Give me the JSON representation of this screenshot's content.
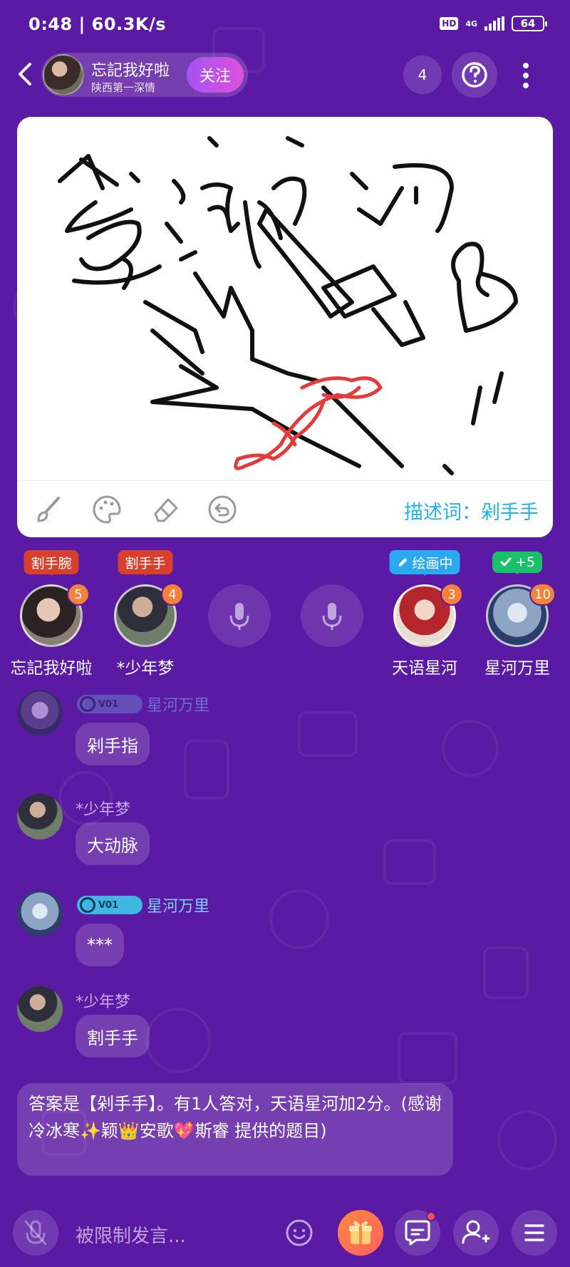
{
  "status_bar": {
    "time_speed": "0:48 | 60.3K/s",
    "hd": "HD",
    "network": "4G",
    "battery": "64"
  },
  "header": {
    "host_name": "忘記我好啦",
    "host_subtitle": "陕西第一深情",
    "follow_label": "关注",
    "online_count": "4"
  },
  "canvas": {
    "hint_label": "描述词：剁手手"
  },
  "seats": [
    {
      "tag": "割手腕",
      "tag_color": "#d8402e",
      "score": "5",
      "name": "忘記我好啦"
    },
    {
      "tag": "割手手",
      "tag_color": "#d8402e",
      "score": "4",
      "name": "*少年梦"
    },
    {
      "empty": true
    },
    {
      "empty": true
    },
    {
      "tag": "绘画中",
      "tag_color": "#2aa8f0",
      "score": "3",
      "name": "天语星河"
    },
    {
      "tag": "+5",
      "tag_color": "#18c16a",
      "score": "10",
      "name": "星河万里"
    }
  ],
  "chat": [
    {
      "user": "星河万里",
      "badge": "V01",
      "message": "剁手指"
    },
    {
      "user": "*少年梦",
      "message": "大动脉"
    },
    {
      "user": "星河万里",
      "badge": "V01",
      "message": "***"
    },
    {
      "user": "*少年梦",
      "message": "割手手"
    }
  ],
  "answer_message": "答案是【剁手手】。有1人答对，天语星河加2分。(感谢 冷冰寒✨颖👑安歌💖斯睿 提供的题目)",
  "input": {
    "placeholder": "被限制发言..."
  },
  "colors": {
    "background": "#5b1aa3",
    "accent_blue": "#1fb3e8",
    "score_orange": "#f5813a"
  }
}
